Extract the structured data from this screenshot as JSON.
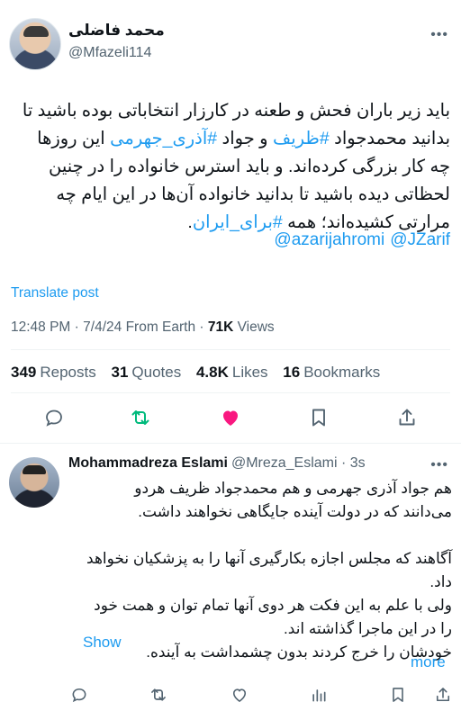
{
  "post": {
    "author_name": "محمد فاضلی",
    "author_handle": "@Mfazeli114",
    "more_label": "•••",
    "text_lines": [
      {
        "pre": "باید زیر باران فحش و طعنه در کارزار انتخاباتی بوده باشید تا",
        "link": "",
        "post": ""
      },
      {
        "pre": "بدانید محمدجواد ",
        "link": "#ظریف",
        "post": " و جواد "
      },
      {
        "pre": "",
        "link": "#آذری_جهرمی",
        "post": " این روزها"
      },
      {
        "pre": "چه کار بزرگی کرده‌اند. و باید استرس خانواده را در چنین",
        "link": "",
        "post": ""
      },
      {
        "pre": "لحظاتی دیده باشید تا بدانید خانواده آن‌ها در این ایام چه",
        "link": "",
        "post": ""
      },
      {
        "pre": "مرارتی کشیده‌اند؛ همه ",
        "link": "#برای_ایران",
        "post": "."
      }
    ],
    "mentions": [
      "@azarijahromi",
      "@JZarif"
    ],
    "translate_label": "Translate post",
    "time": "12:48 PM",
    "date": "7/4/24",
    "source": "From Earth",
    "views_count": "71K",
    "views_label": "Views",
    "stats": [
      {
        "count": "349",
        "label": "Reposts"
      },
      {
        "count": "31",
        "label": "Quotes"
      },
      {
        "count": "4.8K",
        "label": "Likes"
      },
      {
        "count": "16",
        "label": "Bookmarks"
      }
    ],
    "colors": {
      "accent": "#1d9bf0",
      "like": "#f91880",
      "repost": "#00ba7c",
      "muted": "#536471"
    }
  },
  "reply": {
    "name": "Mohammadreza Eslami",
    "handle": "@Mreza_Eslami",
    "age": "3s",
    "more_label": "•••",
    "lines": [
      "هم جواد آذری جهرمی و هم محمدجواد ظریف هردو",
      "می‌دانند که در دولت آینده جایگاهی نخواهند داشت.",
      "",
      "آگاهند که مجلس اجازه بکارگیری آنها را به پزشکیان نخواهد",
      "داد.",
      "ولی با علم به این فکت هر دوی آنها تمام توان و همت خود",
      "را در این ماجرا گذاشته اند.",
      "خودشان را خرج کردند بدون چشمداشت به آینده."
    ],
    "show_more_1": "Show",
    "show_more_2": "more"
  }
}
